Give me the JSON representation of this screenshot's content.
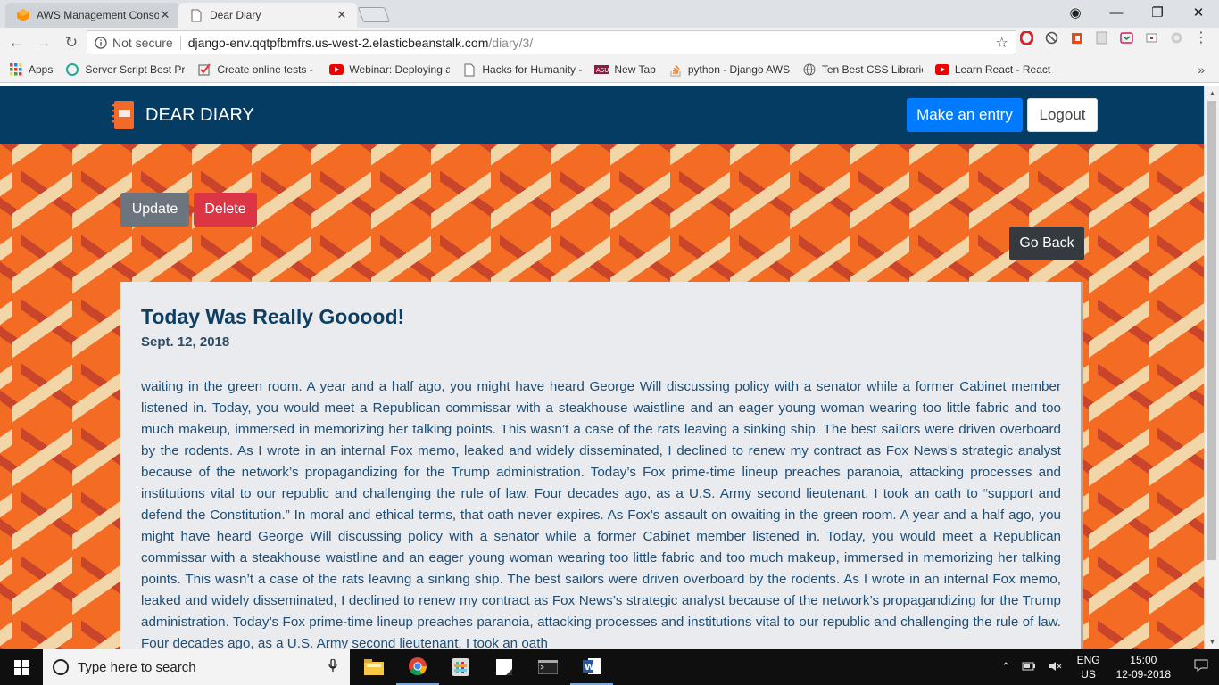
{
  "browser": {
    "tabs": [
      {
        "title": "AWS Management Conso",
        "close": "✕",
        "icon": "aws-icon"
      },
      {
        "title": "Dear Diary",
        "close": "✕",
        "icon": "page-icon"
      }
    ],
    "window_controls": {
      "account": "◉",
      "minimize": "—",
      "restore": "❐",
      "close": "✕"
    },
    "security_label": "Not secure",
    "url_host": "django-env.qqtpfbmfrs.us-west-2.elasticbeanstalk.com",
    "url_path": "/diary/3/",
    "bookmarks": [
      {
        "title": "Apps",
        "icon": "apps-grid-icon"
      },
      {
        "title": "Server Script Best Pra",
        "icon": "server-icon"
      },
      {
        "title": "Create online tests - ",
        "icon": "checkbox-icon"
      },
      {
        "title": "Webinar: Deploying a",
        "icon": "youtube-icon"
      },
      {
        "title": "Hacks for Humanity - ",
        "icon": "page-icon"
      },
      {
        "title": "New Tab",
        "icon": "asu-icon"
      },
      {
        "title": "python - Django AWS",
        "icon": "stackoverflow-icon"
      },
      {
        "title": "Ten Best CSS Librarie",
        "icon": "globe-icon"
      },
      {
        "title": "Learn React - React C",
        "icon": "youtube-icon"
      }
    ],
    "bookmarks_more": "»"
  },
  "app": {
    "brand": "DEAR DIARY",
    "make_entry": "Make an entry",
    "logout": "Logout",
    "update": "Update",
    "delete": "Delete",
    "go_back": "Go Back",
    "entry": {
      "title": "Today Was Really Gooood!",
      "date": "Sept. 12, 2018",
      "body": "waiting in the green room. A year and a half ago, you might have heard George Will discussing policy with a senator while a former Cabinet member listened in. Today, you would meet a Republican commissar with a steakhouse waistline and an eager young woman wearing too little fabric and too much makeup, immersed in memorizing her talking points. This wasn’t a case of the rats leaving a sinking ship. The best sailors were driven overboard by the rodents. As I wrote in an internal Fox memo, leaked and widely disseminated, I declined to renew my contract as Fox News’s strategic analyst because of the network’s propagandizing for the Trump administration. Today’s Fox prime-time lineup preaches paranoia, attacking processes and institutions vital to our republic and challenging the rule of law. Four decades ago, as a U.S. Army second lieutenant, I took an oath to “support and defend the Constitution.” In moral and ethical terms, that oath never expires. As Fox’s assault on owaiting in the green room. A year and a half ago, you might have heard George Will discussing policy with a senator while a former Cabinet member listened in. Today, you would meet a Republican commissar with a steakhouse waistline and an eager young woman wearing too little fabric and too much makeup, immersed in memorizing her talking points. This wasn’t a case of the rats leaving a sinking ship. The best sailors were driven overboard by the rodents. As I wrote in an internal Fox memo, leaked and widely disseminated, I declined to renew my contract as Fox News’s strategic analyst because of the network’s propagandizing for the Trump administration. Today’s Fox prime-time lineup preaches paranoia, attacking processes and institutions vital to our republic and challenging the rule of law. Four decades ago, as a U.S. Army second lieutenant, I took an oath"
    }
  },
  "taskbar": {
    "search_placeholder": "Type here to search",
    "lang_top": "ENG",
    "lang_bottom": "US",
    "time": "15:00",
    "date": "12-09-2018"
  },
  "colors": {
    "navbar": "#043c63",
    "page_background": "#f46b23",
    "primary_button": "#007bff",
    "secondary_button": "#6c757d",
    "danger_button": "#dc3545",
    "dark_button": "#343a40",
    "card": "#e9ebef"
  }
}
